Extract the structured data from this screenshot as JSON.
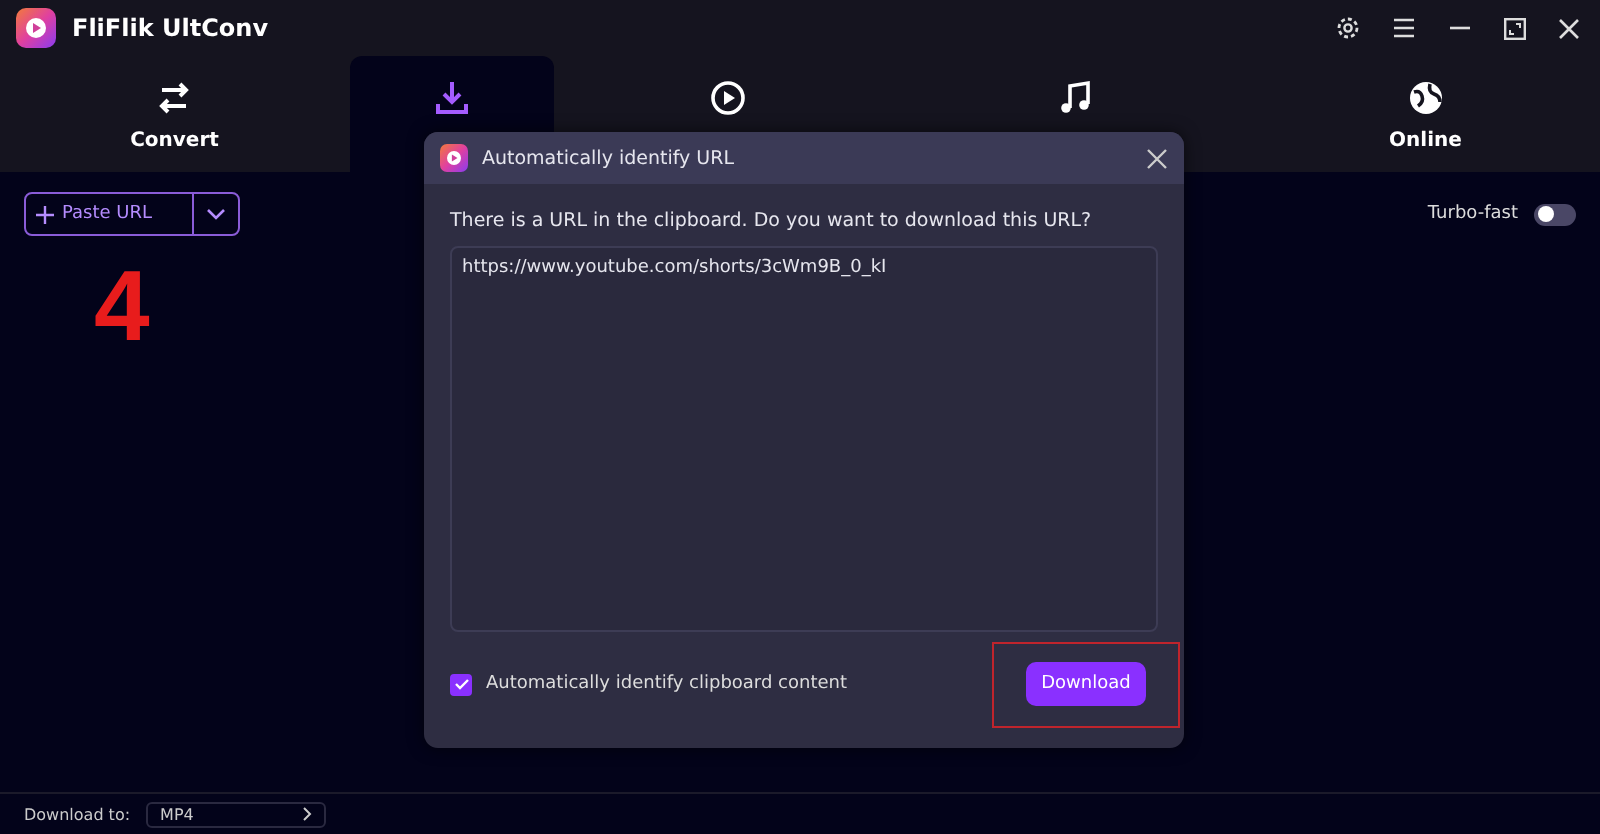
{
  "window": {
    "title": "FliFlik UltConv"
  },
  "tabs": [
    {
      "label": "Convert",
      "kind": "convert",
      "selected": false
    },
    {
      "kind": "download",
      "selected": true
    },
    {
      "kind": "play",
      "selected": false
    },
    {
      "kind": "music",
      "selected": false
    },
    {
      "label": "Online",
      "kind": "globe",
      "selected": false
    }
  ],
  "toolbar": {
    "paste_button": "Paste URL",
    "turbo_label": "Turbo-fast",
    "turbo_on": false
  },
  "step_number": "4",
  "dialog": {
    "title": "Automatically identify URL",
    "message": "There is a URL in the clipboard. Do you want to download this URL?",
    "url": "https://www.youtube.com/shorts/3cWm9B_0_kI",
    "auto_identify_label": "Automatically identify clipboard content",
    "auto_identify_checked": true,
    "download_button": "Download",
    "download_highlighted": true
  },
  "footer": {
    "label": "Download to:",
    "format": "MP4"
  }
}
